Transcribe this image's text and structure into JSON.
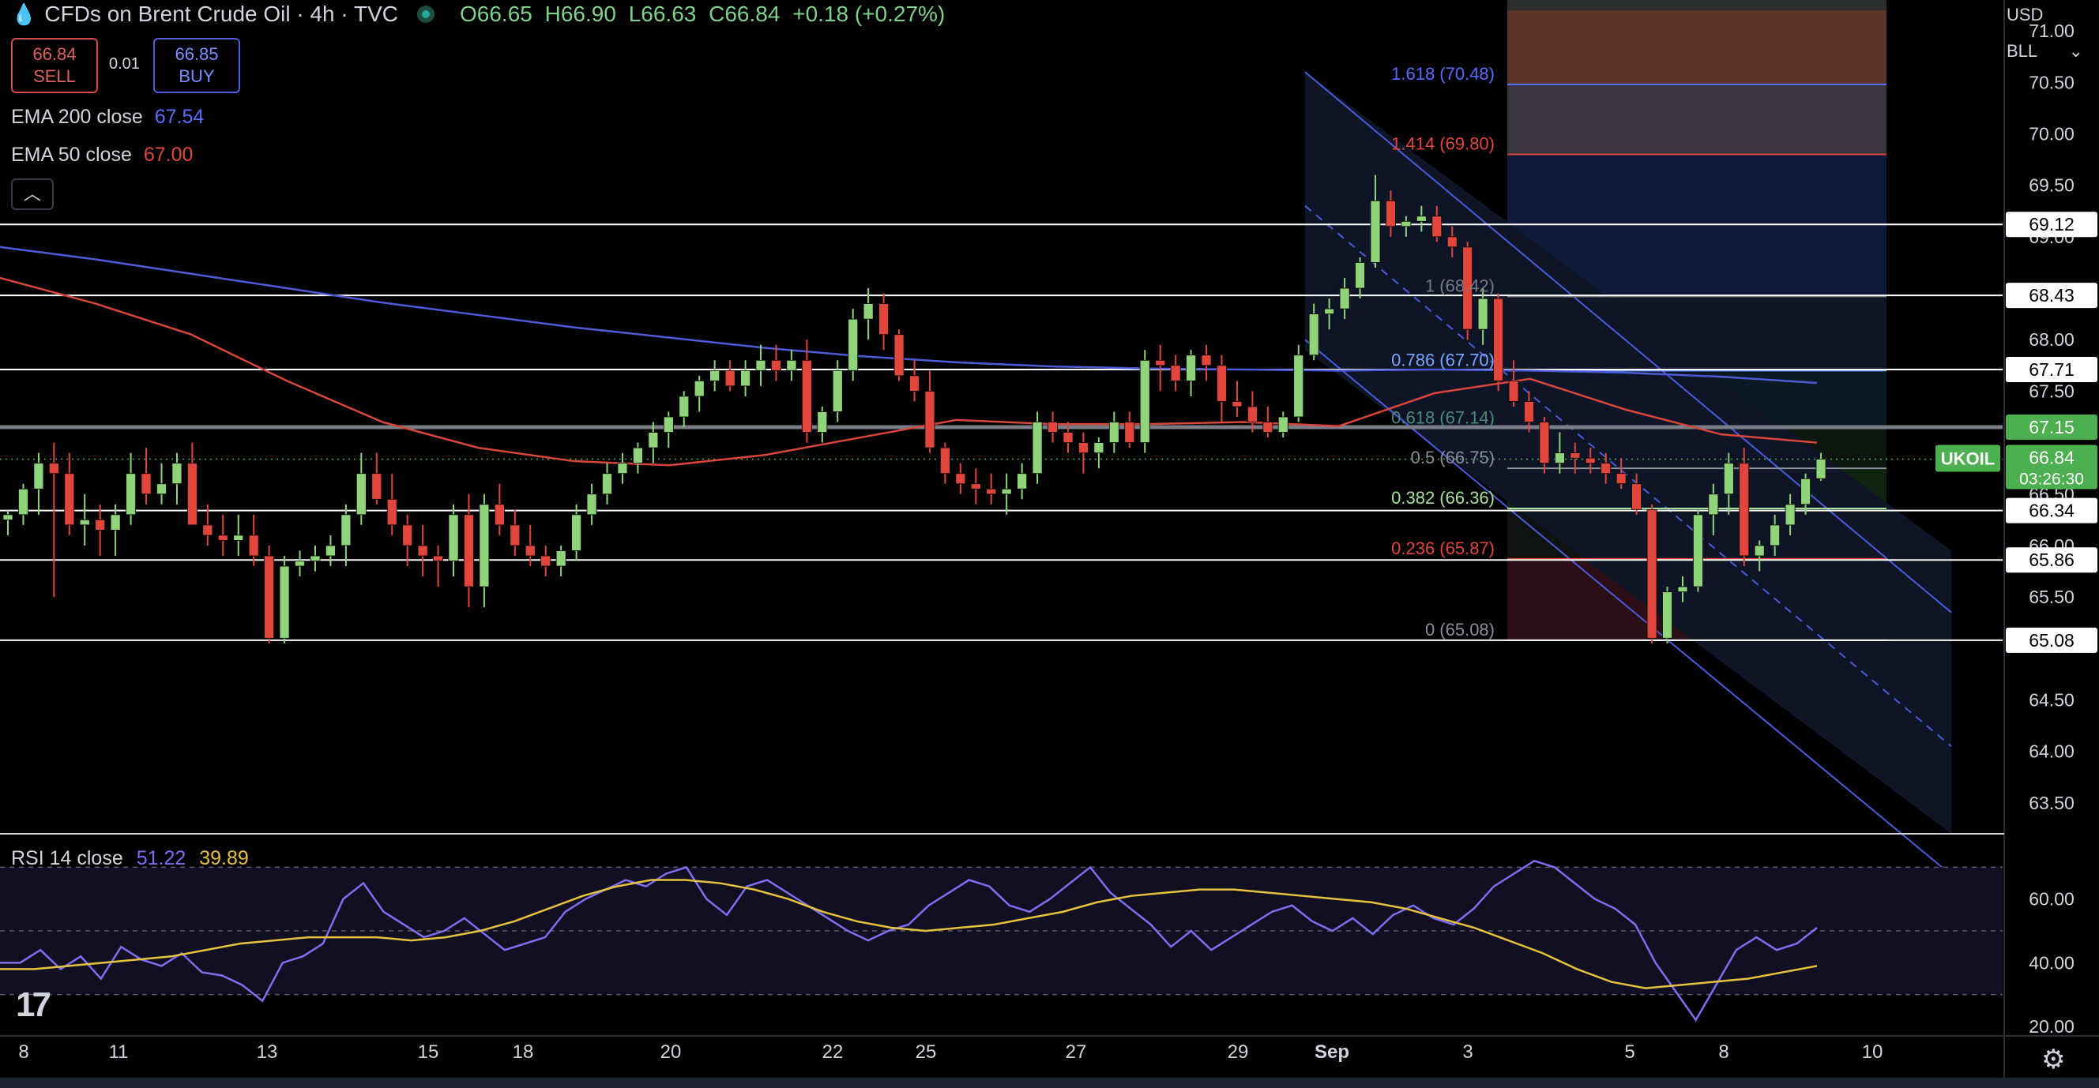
{
  "header": {
    "icon": "drop-icon",
    "title": "CFDs on Brent Crude Oil · 4h · TVC",
    "open": "O66.65",
    "high": "H66.90",
    "low": "L66.63",
    "close": "C66.84",
    "change": "+0.18 (+0.27%)"
  },
  "trade": {
    "sell_price": "66.84",
    "sell_label": "SELL",
    "spread": "0.01",
    "buy_price": "66.85",
    "buy_label": "BUY"
  },
  "indicators": {
    "ema200_label": "EMA 200 close",
    "ema200_value": "67.54",
    "ema50_label": "EMA 50 close",
    "ema50_value": "67.00",
    "rsi_label": "RSI 14 close",
    "rsi_value": "51.22",
    "rsi_ma_value": "39.89"
  },
  "currency": {
    "primary": "USD",
    "unit": "BLL"
  },
  "colors": {
    "up": "#8fd47a",
    "down": "#e0463c",
    "ema200": "#4e5bd9",
    "ema50": "#d9463c",
    "rsi": "#7e6ff0",
    "rsi_ma": "#e8c13c",
    "level": "#ffffff",
    "price_tag": "#4caf50"
  },
  "chart_data": {
    "type": "candlestick",
    "symbol": "UKOIL",
    "countdown": "03:26:30",
    "current_price": 66.84,
    "ylim": [
      63.2,
      71.3
    ],
    "y_ticks": [
      "71.00",
      "70.50",
      "70.00",
      "69.50",
      "69.00",
      "68.00",
      "67.50",
      "66.50",
      "66.00",
      "65.50",
      "64.50",
      "64.00",
      "63.50"
    ],
    "x_tick_labels": [
      "8",
      "11",
      "13",
      "15",
      "18",
      "20",
      "22",
      "25",
      "27",
      "29",
      "Sep",
      "3",
      "5",
      "8",
      "10"
    ],
    "levels": [
      69.12,
      68.43,
      67.71,
      67.15,
      66.34,
      65.86,
      65.08
    ],
    "level_labels": [
      "69.12",
      "68.43",
      "67.71",
      "67.15",
      "66.34",
      "65.86",
      "65.08"
    ],
    "fib_levels": [
      {
        "ratio": "1.618",
        "price": "70.48",
        "color": "#5b6bff"
      },
      {
        "ratio": "1.414",
        "price": "69.80",
        "color": "#e0463c"
      },
      {
        "ratio": "1",
        "price": "68.42",
        "color": "#787b86"
      },
      {
        "ratio": "0.786",
        "price": "67.70",
        "color": "#7aa7ff"
      },
      {
        "ratio": "0.618",
        "price": "67.14",
        "color": "#4e8a78"
      },
      {
        "ratio": "0.5",
        "price": "66.75",
        "color": "#8a8e99"
      },
      {
        "ratio": "0.382",
        "price": "66.36",
        "color": "#a8e09a"
      },
      {
        "ratio": "0.236",
        "price": "65.87",
        "color": "#e0463c"
      },
      {
        "ratio": "0",
        "price": "65.08",
        "color": "#8a8e99"
      }
    ],
    "candles": [
      [
        66.25,
        66.35,
        66.1,
        66.3
      ],
      [
        66.3,
        66.6,
        66.2,
        66.55
      ],
      [
        66.55,
        66.9,
        66.3,
        66.8
      ],
      [
        66.8,
        67.0,
        65.5,
        66.7
      ],
      [
        66.7,
        66.9,
        66.1,
        66.2
      ],
      [
        66.2,
        66.5,
        66.0,
        66.25
      ],
      [
        66.25,
        66.4,
        65.9,
        66.15
      ],
      [
        66.15,
        66.4,
        65.9,
        66.3
      ],
      [
        66.3,
        66.9,
        66.2,
        66.7
      ],
      [
        66.7,
        66.95,
        66.4,
        66.5
      ],
      [
        66.5,
        66.8,
        66.4,
        66.6
      ],
      [
        66.6,
        66.9,
        66.4,
        66.8
      ],
      [
        66.8,
        67.0,
        66.2,
        66.2
      ],
      [
        66.2,
        66.4,
        66.0,
        66.1
      ],
      [
        66.1,
        66.3,
        65.9,
        66.05
      ],
      [
        66.05,
        66.3,
        65.9,
        66.1
      ],
      [
        66.1,
        66.3,
        65.8,
        65.9
      ],
      [
        65.9,
        66.0,
        65.05,
        65.1
      ],
      [
        65.1,
        65.9,
        65.05,
        65.8
      ],
      [
        65.8,
        65.95,
        65.7,
        65.85
      ],
      [
        65.85,
        66.0,
        65.75,
        65.9
      ],
      [
        65.9,
        66.1,
        65.8,
        66.0
      ],
      [
        66.0,
        66.4,
        65.8,
        66.3
      ],
      [
        66.3,
        66.9,
        66.2,
        66.7
      ],
      [
        66.7,
        66.9,
        66.4,
        66.45
      ],
      [
        66.45,
        66.7,
        66.1,
        66.2
      ],
      [
        66.2,
        66.3,
        65.8,
        66.0
      ],
      [
        66.0,
        66.2,
        65.7,
        65.9
      ],
      [
        65.9,
        66.0,
        65.6,
        65.85
      ],
      [
        65.85,
        66.4,
        65.7,
        66.3
      ],
      [
        66.3,
        66.5,
        65.4,
        65.6
      ],
      [
        65.6,
        66.5,
        65.4,
        66.4
      ],
      [
        66.4,
        66.6,
        66.1,
        66.2
      ],
      [
        66.2,
        66.35,
        65.9,
        66.0
      ],
      [
        66.0,
        66.2,
        65.8,
        65.9
      ],
      [
        65.9,
        66.0,
        65.7,
        65.8
      ],
      [
        65.8,
        66.0,
        65.7,
        65.95
      ],
      [
        65.95,
        66.4,
        65.85,
        66.3
      ],
      [
        66.3,
        66.6,
        66.2,
        66.5
      ],
      [
        66.5,
        66.8,
        66.4,
        66.7
      ],
      [
        66.7,
        66.9,
        66.6,
        66.8
      ],
      [
        66.8,
        67.0,
        66.7,
        66.95
      ],
      [
        66.95,
        67.2,
        66.8,
        67.1
      ],
      [
        67.1,
        67.3,
        66.95,
        67.25
      ],
      [
        67.25,
        67.5,
        67.15,
        67.45
      ],
      [
        67.45,
        67.65,
        67.3,
        67.6
      ],
      [
        67.6,
        67.8,
        67.5,
        67.7
      ],
      [
        67.7,
        67.8,
        67.5,
        67.55
      ],
      [
        67.55,
        67.8,
        67.45,
        67.7
      ],
      [
        67.7,
        67.95,
        67.55,
        67.8
      ],
      [
        67.8,
        67.95,
        67.6,
        67.7
      ],
      [
        67.7,
        67.9,
        67.6,
        67.8
      ],
      [
        67.8,
        68.0,
        67.0,
        67.1
      ],
      [
        67.1,
        67.35,
        67.0,
        67.3
      ],
      [
        67.3,
        67.8,
        67.2,
        67.7
      ],
      [
        67.7,
        68.3,
        67.6,
        68.2
      ],
      [
        68.2,
        68.5,
        68.0,
        68.35
      ],
      [
        68.35,
        68.45,
        67.9,
        68.05
      ],
      [
        68.05,
        68.1,
        67.6,
        67.65
      ],
      [
        67.65,
        67.8,
        67.4,
        67.5
      ],
      [
        67.5,
        67.7,
        66.9,
        66.95
      ],
      [
        66.95,
        67.0,
        66.6,
        66.7
      ],
      [
        66.7,
        66.8,
        66.5,
        66.6
      ],
      [
        66.6,
        66.75,
        66.4,
        66.55
      ],
      [
        66.55,
        66.7,
        66.4,
        66.5
      ],
      [
        66.5,
        66.7,
        66.3,
        66.55
      ],
      [
        66.55,
        66.8,
        66.45,
        66.7
      ],
      [
        66.7,
        67.3,
        66.6,
        67.2
      ],
      [
        67.2,
        67.3,
        67.0,
        67.1
      ],
      [
        67.1,
        67.2,
        66.9,
        67.0
      ],
      [
        67.0,
        67.1,
        66.7,
        66.9
      ],
      [
        66.9,
        67.05,
        66.75,
        67.0
      ],
      [
        67.0,
        67.3,
        66.9,
        67.2
      ],
      [
        67.2,
        67.3,
        66.95,
        67.0
      ],
      [
        67.0,
        67.9,
        66.9,
        67.8
      ],
      [
        67.8,
        67.95,
        67.5,
        67.75
      ],
      [
        67.75,
        67.85,
        67.5,
        67.6
      ],
      [
        67.6,
        67.9,
        67.45,
        67.85
      ],
      [
        67.85,
        67.95,
        67.6,
        67.75
      ],
      [
        67.75,
        67.85,
        67.2,
        67.4
      ],
      [
        67.4,
        67.6,
        67.25,
        67.35
      ],
      [
        67.35,
        67.5,
        67.1,
        67.2
      ],
      [
        67.2,
        67.35,
        67.05,
        67.1
      ],
      [
        67.1,
        67.3,
        67.05,
        67.25
      ],
      [
        67.25,
        67.95,
        67.2,
        67.85
      ],
      [
        67.85,
        68.35,
        67.8,
        68.25
      ],
      [
        68.25,
        68.4,
        68.1,
        68.3
      ],
      [
        68.3,
        68.6,
        68.2,
        68.5
      ],
      [
        68.5,
        68.8,
        68.4,
        68.75
      ],
      [
        68.75,
        69.6,
        68.7,
        69.35
      ],
      [
        69.35,
        69.45,
        69.0,
        69.1
      ],
      [
        69.1,
        69.2,
        69.0,
        69.15
      ],
      [
        69.15,
        69.3,
        69.05,
        69.2
      ],
      [
        69.2,
        69.3,
        68.95,
        69.0
      ],
      [
        69.0,
        69.1,
        68.8,
        68.9
      ],
      [
        68.9,
        68.95,
        68.0,
        68.1
      ],
      [
        68.1,
        68.5,
        67.95,
        68.4
      ],
      [
        68.4,
        68.45,
        67.5,
        67.6
      ],
      [
        67.6,
        67.8,
        67.35,
        67.4
      ],
      [
        67.4,
        67.5,
        67.1,
        67.2
      ],
      [
        67.2,
        67.25,
        66.7,
        66.8
      ],
      [
        66.8,
        67.1,
        66.7,
        66.9
      ],
      [
        66.9,
        67.0,
        66.7,
        66.85
      ],
      [
        66.85,
        66.95,
        66.7,
        66.8
      ],
      [
        66.8,
        66.9,
        66.6,
        66.7
      ],
      [
        66.7,
        66.85,
        66.55,
        66.6
      ],
      [
        66.6,
        66.7,
        66.3,
        66.35
      ],
      [
        66.35,
        66.4,
        65.05,
        65.1
      ],
      [
        65.1,
        65.6,
        65.05,
        65.55
      ],
      [
        65.55,
        65.7,
        65.45,
        65.6
      ],
      [
        65.6,
        66.35,
        65.55,
        66.3
      ],
      [
        66.3,
        66.6,
        66.1,
        66.5
      ],
      [
        66.5,
        66.9,
        66.3,
        66.8
      ],
      [
        66.8,
        66.95,
        65.8,
        65.9
      ],
      [
        65.9,
        66.05,
        65.75,
        66.0
      ],
      [
        66.0,
        66.3,
        65.9,
        66.2
      ],
      [
        66.2,
        66.5,
        66.1,
        66.4
      ],
      [
        66.4,
        66.7,
        66.3,
        66.65
      ],
      [
        66.65,
        66.9,
        66.63,
        66.84
      ]
    ],
    "ema200": [
      68.9,
      68.78,
      68.64,
      68.5,
      68.36,
      68.24,
      68.12,
      68.02,
      67.92,
      67.84,
      67.78,
      67.74,
      67.72,
      67.71,
      67.7,
      67.71,
      67.7,
      67.68,
      67.64,
      67.58
    ],
    "ema50": [
      68.6,
      68.35,
      68.05,
      67.6,
      67.2,
      66.95,
      66.82,
      66.78,
      66.88,
      67.05,
      67.22,
      67.18,
      67.18,
      67.2,
      67.16,
      67.48,
      67.62,
      67.32,
      67.08,
      67.0
    ],
    "rsi_ticks": [
      "60.00",
      "40.00",
      "20.00"
    ],
    "rsi_band": [
      70,
      30
    ],
    "rsi": [
      40,
      40,
      44,
      38,
      42,
      35,
      45,
      41,
      39,
      43,
      37,
      36,
      33,
      28,
      40,
      42,
      46,
      60,
      65,
      56,
      52,
      48,
      50,
      54,
      49,
      44,
      46,
      48,
      56,
      60,
      63,
      66,
      64,
      68,
      70,
      60,
      55,
      64,
      66,
      62,
      58,
      54,
      50,
      47,
      50,
      52,
      58,
      62,
      66,
      64,
      58,
      56,
      60,
      65,
      70,
      62,
      57,
      52,
      45,
      50,
      44,
      48,
      52,
      56,
      58,
      53,
      50,
      54,
      49,
      55,
      58,
      54,
      52,
      57,
      64,
      68,
      72,
      70,
      65,
      60,
      57,
      52,
      40,
      31,
      22,
      33,
      44,
      48,
      44,
      46,
      51
    ],
    "rsi_ma": [
      38,
      38,
      39,
      40,
      41,
      42,
      44,
      46,
      47,
      48,
      48,
      48,
      47,
      48,
      50,
      53,
      57,
      61,
      64,
      66,
      66,
      65,
      63,
      60,
      56,
      53,
      51,
      50,
      51,
      52,
      54,
      56,
      59,
      61,
      62,
      63,
      63,
      62,
      61,
      60,
      59,
      57,
      54,
      51,
      47,
      43,
      38,
      34,
      32,
      33,
      34,
      35,
      37,
      39
    ]
  }
}
